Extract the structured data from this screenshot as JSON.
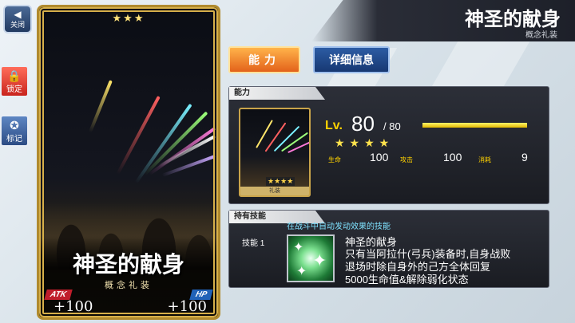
{
  "nav": {
    "close_label": "关闭",
    "lock_label": "锁定",
    "mark_label": "标记"
  },
  "card": {
    "rarity_stars": "★★★",
    "name": "神圣的献身",
    "type": "概念礼装",
    "atk_label": "ATK",
    "atk_value": "+100",
    "hp_label": "HP",
    "hp_value": "+100"
  },
  "header": {
    "title": "神圣的献身",
    "subtitle": "概念礼装"
  },
  "tabs": {
    "ability": "能力",
    "detail": "详细信息"
  },
  "ability_panel": {
    "heading": "能力",
    "thumb_stars": "★★★★",
    "thumb_label": "礼装",
    "level_label": "Lv.",
    "level": "80",
    "level_max": "/ 80",
    "level_fraction": 1.0,
    "rarity": "★★★★",
    "stats": [
      {
        "key": "生命",
        "value": "100"
      },
      {
        "key": "攻击",
        "value": "100"
      },
      {
        "key": "消耗",
        "value": "9"
      }
    ]
  },
  "skill_panel": {
    "heading": "持有技能",
    "hint": "在战斗中自动发动效果的技能",
    "skill_label": "技能 1",
    "skill_name": "神圣的献身",
    "skill_desc": [
      "只有当阿拉什(弓兵)装备时,自身战败",
      "退场时除自身外的己方全体回复",
      "5000生命值&解除弱化状态"
    ]
  },
  "colors": {
    "accent_gold": "#ffd200",
    "tab_orange": "#e3621a",
    "tab_blue": "#173872",
    "atk_red": "#c01d2b",
    "hp_blue": "#2062b8"
  }
}
